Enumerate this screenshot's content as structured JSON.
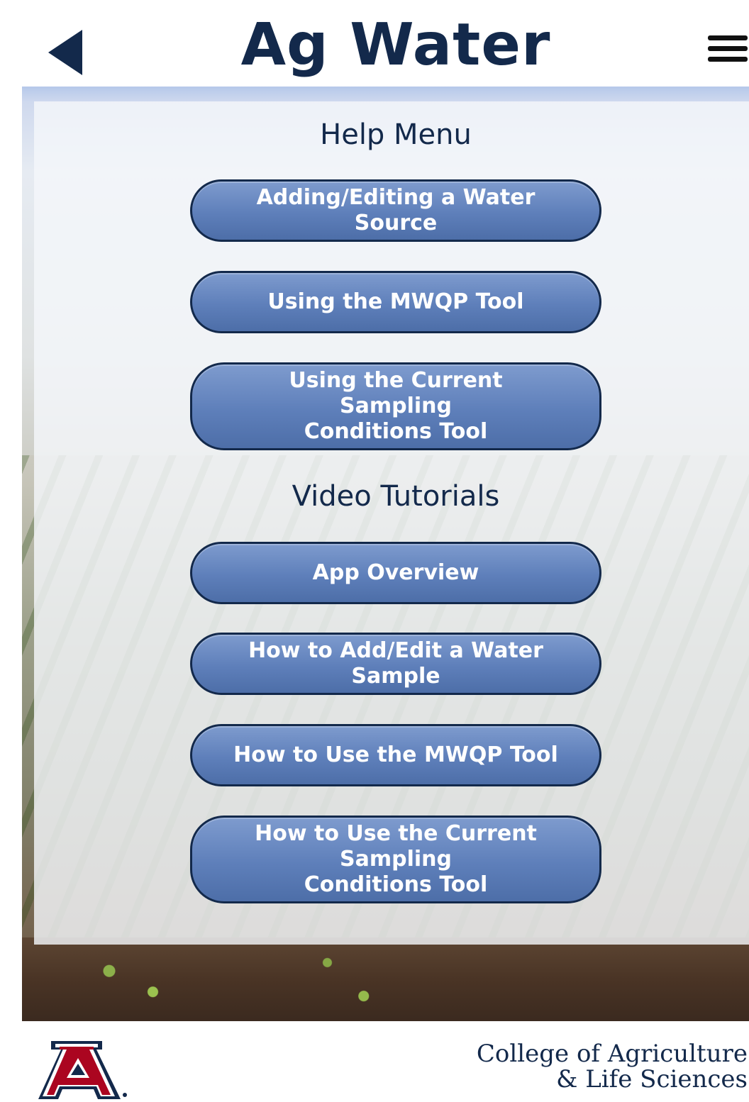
{
  "header": {
    "title": "Ag Water",
    "back_icon": "back-arrow-icon",
    "menu_icon": "hamburger-menu-icon"
  },
  "help_menu": {
    "title": "Help Menu",
    "buttons": [
      {
        "label": "Adding/Editing a Water Source"
      },
      {
        "label": "Using the MWQP Tool"
      },
      {
        "label_line1": "Using the Current Sampling",
        "label_line2": "Conditions Tool"
      }
    ]
  },
  "video_tutorials": {
    "title": "Video Tutorials",
    "buttons": [
      {
        "label": "App Overview"
      },
      {
        "label": "How to Add/Edit a Water Sample"
      },
      {
        "label": "How to Use the MWQP Tool"
      },
      {
        "label_line1": "How to Use the Current Sampling",
        "label_line2": "Conditions Tool"
      }
    ]
  },
  "footer": {
    "logo_letter": "A",
    "college_line1": "College of Agriculture",
    "college_line2": "& Life Sciences"
  },
  "colors": {
    "navy": "#13294b",
    "button_blue": "#5e7fba",
    "ua_red": "#ab0520"
  }
}
